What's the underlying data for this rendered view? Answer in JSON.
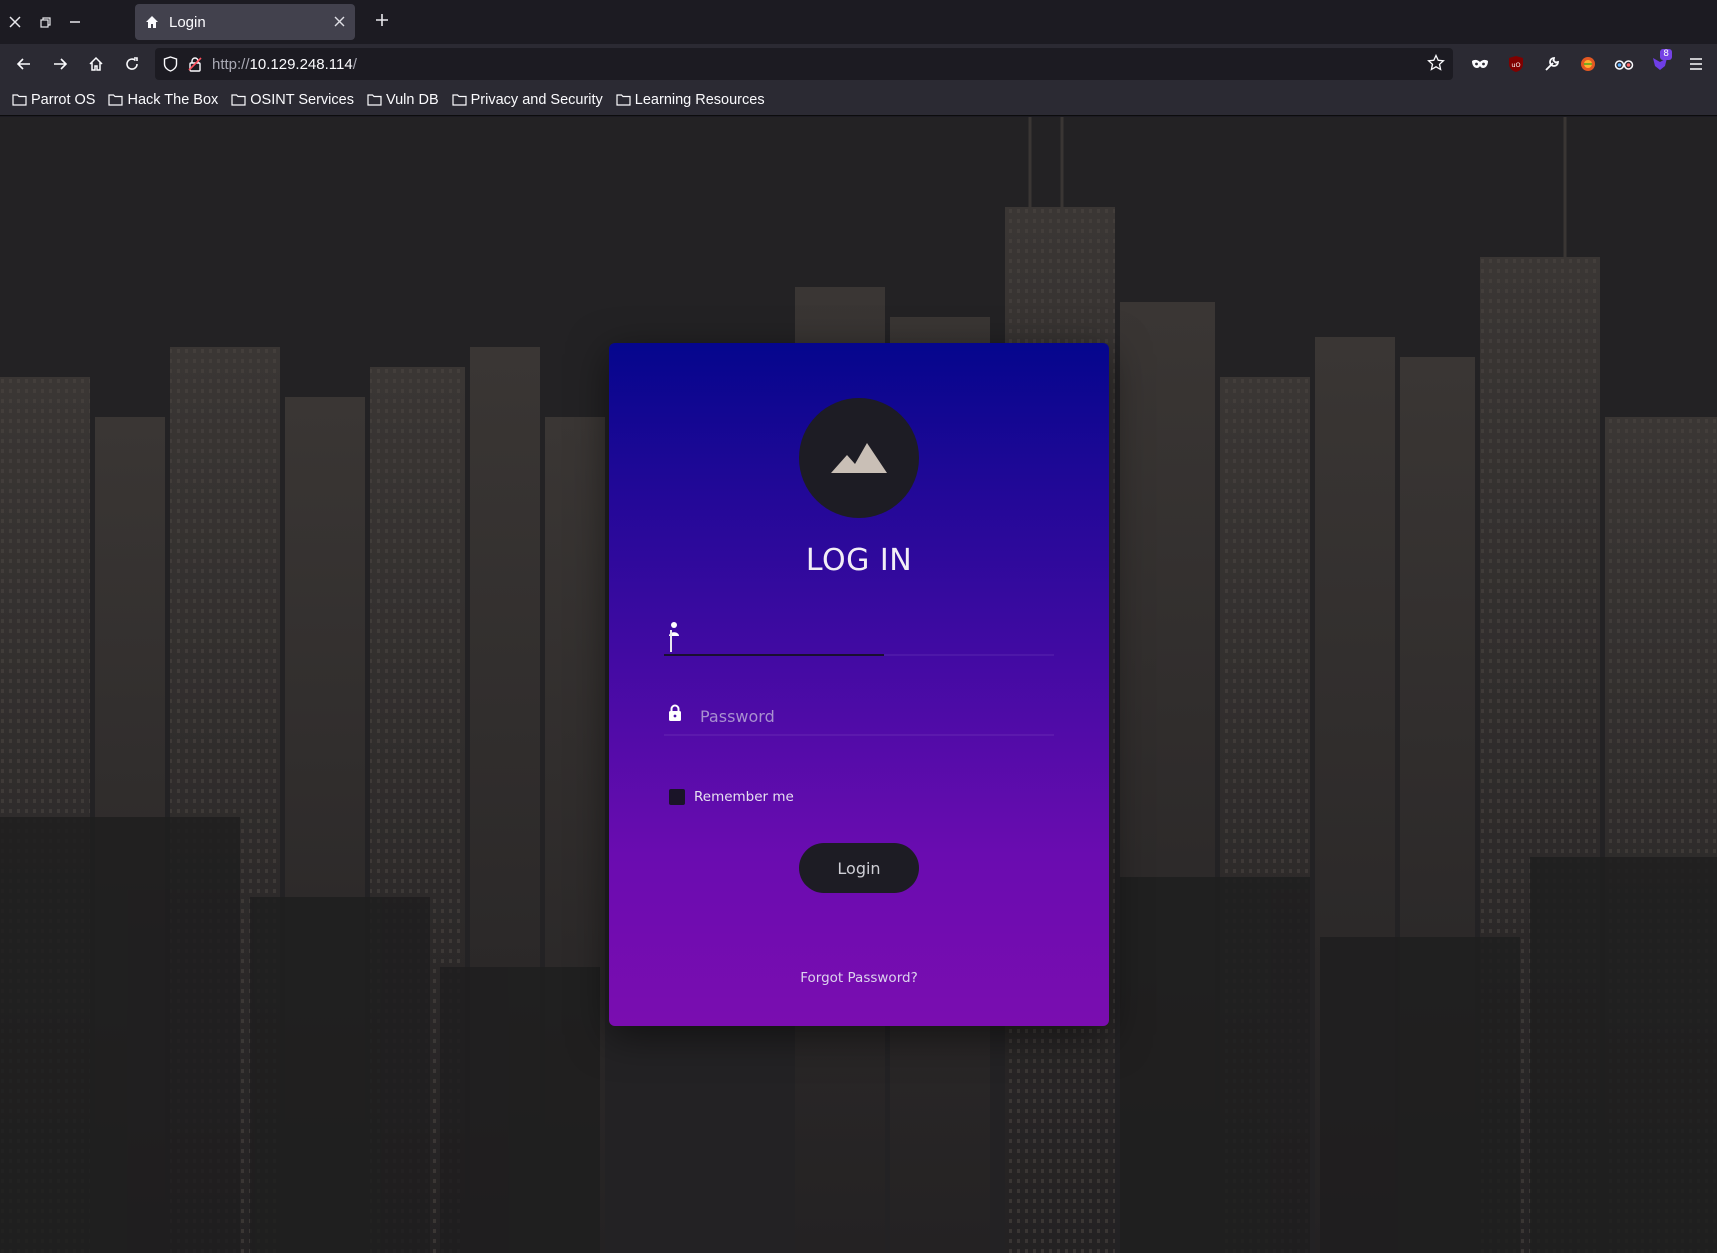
{
  "browser": {
    "tab": {
      "title": "Login"
    },
    "url": {
      "protocol": "http://",
      "host": "10.129.248.114",
      "path": "/"
    },
    "extensions_badge": "8",
    "bookmarks": [
      {
        "label": "Parrot OS"
      },
      {
        "label": "Hack The Box"
      },
      {
        "label": "OSINT Services"
      },
      {
        "label": "Vuln DB"
      },
      {
        "label": "Privacy and Security"
      },
      {
        "label": "Learning Resources"
      }
    ]
  },
  "login": {
    "title": "LOG IN",
    "username": {
      "value": "",
      "placeholder": ""
    },
    "password": {
      "value": "",
      "placeholder": "Password"
    },
    "remember_label": "Remember me",
    "remember_checked": false,
    "submit_label": "Login",
    "forgot_label": "Forgot Password?"
  },
  "colors": {
    "card_top": "#05068d",
    "card_bottom": "#7a0db0",
    "button_bg": "#1d1c24"
  }
}
